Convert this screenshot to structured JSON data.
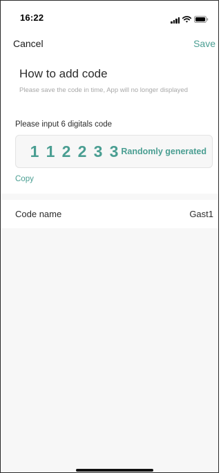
{
  "status_bar": {
    "time": "16:22",
    "icons": [
      "cellular-signal-icon",
      "wifi-icon",
      "battery-icon"
    ]
  },
  "nav": {
    "cancel_label": "Cancel",
    "save_label": "Save"
  },
  "header": {
    "title": "How to add code",
    "subtitle": "Please save the code in time, App will no longer displayed"
  },
  "code_section": {
    "label": "Please input 6 digitals code",
    "digits": [
      "1",
      "1",
      "2",
      "2",
      "3",
      "3"
    ],
    "random_label": "Randomly generated",
    "copy_label": "Copy"
  },
  "code_name": {
    "label": "Code name",
    "value": "Gast1"
  },
  "colors": {
    "accent": "#4a9e92",
    "text": "#2b2b2b",
    "muted": "#a8a8a8",
    "background": "#f7f7f7"
  }
}
